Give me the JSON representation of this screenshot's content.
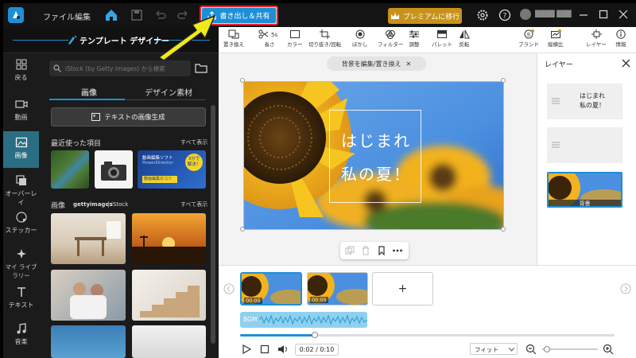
{
  "titlebar": {
    "menu_file": "ファイル",
    "menu_edit": "編集",
    "export_label": "書き出し＆共有",
    "premium_label": "プレミアムに移行",
    "username": "████ ███"
  },
  "template_header": {
    "title": "テンプレート デザイナー"
  },
  "rail": [
    {
      "label": "戻る",
      "icon": "grid-icon"
    },
    {
      "label": "動画",
      "icon": "video-icon"
    },
    {
      "label": "画像",
      "icon": "image-icon"
    },
    {
      "label": "オーバーレイ",
      "icon": "overlay-icon"
    },
    {
      "label": "ステッカー",
      "icon": "sticker-icon"
    },
    {
      "label": "マイ ライブラリー",
      "icon": "library-icon"
    },
    {
      "label": "テキスト",
      "icon": "text-icon"
    },
    {
      "label": "音楽",
      "icon": "music-icon"
    }
  ],
  "left_panel": {
    "search_placeholder": "iStock (by Getty Images) から検索",
    "tab_image": "画像",
    "tab_design": "デザイン素材",
    "ai_button": "テキストの画像生成",
    "recent_title": "最近使った項目",
    "show_all": "すべて表示",
    "images_title": "画像",
    "getty": "gettyimages",
    "istock": "iStock",
    "show_all2": "すべて表示",
    "ad_line1": "動画編集ソフト",
    "ad_line2": "PowerDirector",
    "ad_line3": "3分で",
    "ad_line4": "解決！",
    "ad_line5": "動画編集のコツ"
  },
  "toolbar": [
    {
      "label": "置き換え",
      "icon": "replace-icon"
    },
    {
      "label": "長さ",
      "icon": "scissors-icon",
      "extra": "5s"
    },
    {
      "label": "カラー",
      "icon": "color-icon"
    },
    {
      "label": "切り抜き/回転",
      "icon": "crop-icon"
    },
    {
      "label": "ぼかし",
      "icon": "blur-icon"
    },
    {
      "label": "フィルター",
      "icon": "filter-icon"
    },
    {
      "label": "調整",
      "icon": "adjust-icon"
    },
    {
      "label": "パレット",
      "icon": "palette-icon"
    },
    {
      "label": "反転",
      "icon": "flip-icon"
    },
    {
      "label": "ブランド",
      "icon": "brand-icon"
    },
    {
      "label": "縦横比",
      "icon": "aspect-icon"
    },
    {
      "label": "レイヤー",
      "icon": "layers-icon"
    },
    {
      "label": "情報",
      "icon": "info-icon"
    }
  ],
  "canvas": {
    "replace_bg": "背景を編集/置き換え",
    "text_line1": "はじまれ",
    "text_line2": "私の夏！"
  },
  "layers": {
    "title": "レイヤー",
    "layer1": "はじまれ\n私の夏！",
    "bg_label": "背景"
  },
  "timeline": {
    "clip1_time": "00:05",
    "clip2_time": "00:05",
    "bgm": "BGM",
    "time_current": "0:02",
    "time_total": "0:10",
    "time_display": "0:02 / 0:10",
    "fit": "フィット",
    "progress": 0.2
  },
  "colors": {
    "accent": "#1d8fd6",
    "premium": "#c8921a",
    "active_rail": "#2a6e84",
    "export_border": "#e8232a"
  }
}
